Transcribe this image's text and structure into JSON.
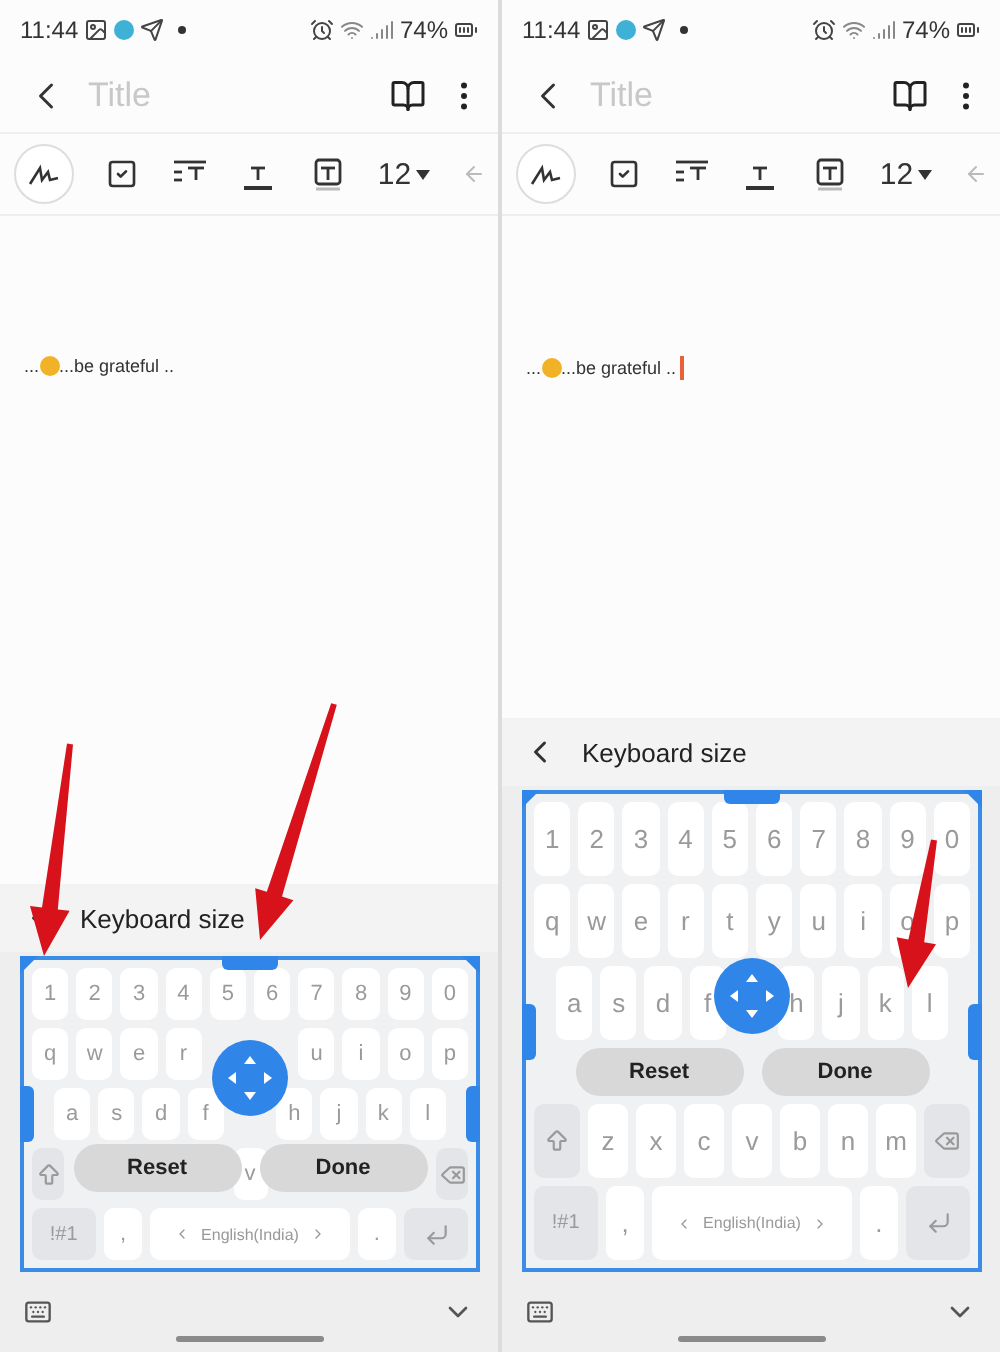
{
  "panels": [
    {
      "status_bar": {
        "time": "11:44",
        "battery": "74%"
      },
      "header": {
        "title_placeholder": "Title"
      },
      "toolbar": {
        "font_size": "12"
      },
      "note": {
        "text_before": "...",
        "text_after": "...be grateful ..",
        "cursor": false
      },
      "keyboard": {
        "title": "Keyboard size",
        "kind": "compact",
        "reset": "Reset",
        "done": "Done",
        "rows": [
          {
            "kind": "digits",
            "keys": [
              "1",
              "2",
              "3",
              "4",
              "5",
              "6",
              "7",
              "8",
              "9",
              "0"
            ]
          },
          {
            "kind": "letters-split",
            "keys": [
              "q",
              "w",
              "e",
              "r"
            ],
            "keys_after": [
              "u",
              "i",
              "o",
              "p"
            ]
          },
          {
            "kind": "home-split",
            "keys": [
              "a",
              "s",
              "d",
              "f"
            ],
            "keys_after": [
              "h",
              "j",
              "k",
              "l"
            ]
          },
          {
            "kind": "shift",
            "keys": [
              "v"
            ]
          },
          {
            "kind": "bottom",
            "keys": [
              "!#1",
              ",",
              "English(India)",
              "."
            ]
          }
        ]
      },
      "annotations": [
        {
          "kind": "corner"
        },
        {
          "kind": "top-handle"
        }
      ]
    },
    {
      "status_bar": {
        "time": "11:44",
        "battery": "74%"
      },
      "header": {
        "title_placeholder": "Title"
      },
      "toolbar": {
        "font_size": "12"
      },
      "note": {
        "text_before": "...",
        "text_after": "...be grateful ..",
        "cursor": true
      },
      "keyboard": {
        "title": "Keyboard size",
        "kind": "tall",
        "reset": "Reset",
        "done": "Done",
        "rows": [
          {
            "kind": "digits",
            "keys": [
              "1",
              "2",
              "3",
              "4",
              "5",
              "6",
              "7",
              "8",
              "9",
              "0"
            ]
          },
          {
            "kind": "letters",
            "keys": [
              "q",
              "w",
              "e",
              "r",
              "t",
              "y",
              "u",
              "i",
              "o",
              "p"
            ]
          },
          {
            "kind": "home-split",
            "keys": [
              "a",
              "s",
              "d",
              "f"
            ],
            "keys_after": [
              "h",
              "j",
              "k",
              "l"
            ]
          },
          {
            "kind": "shift",
            "keys": [
              "z",
              "x",
              "c",
              "v",
              "b",
              "n",
              "m"
            ]
          },
          {
            "kind": "bottom",
            "keys": [
              "!#1",
              ",",
              "English(India)",
              "."
            ]
          }
        ]
      },
      "annotations": [
        {
          "kind": "key"
        }
      ]
    }
  ]
}
